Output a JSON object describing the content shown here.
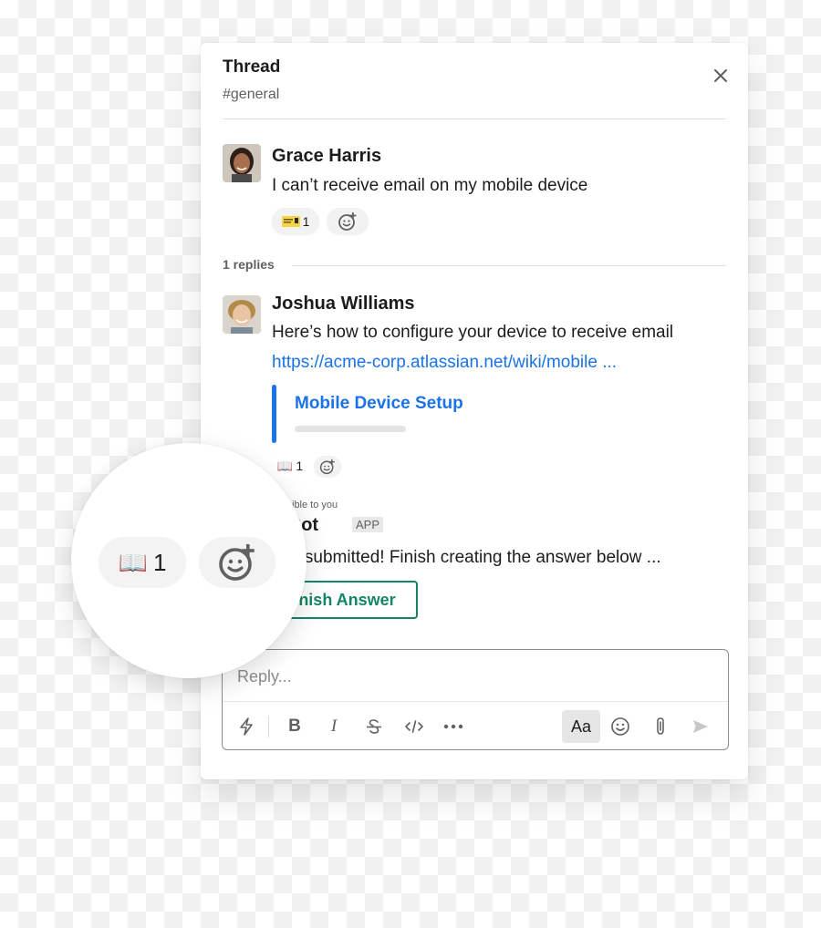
{
  "thread": {
    "title": "Thread",
    "channel": "#general"
  },
  "messages": [
    {
      "author": "Grace Harris",
      "text": "I can’t receive email on my mobile device",
      "reactions": [
        {
          "emoji": "ticket-emoji",
          "count": "1"
        }
      ]
    },
    {
      "author": "Joshua Williams",
      "text": "Here’s how to configure your device to receive email",
      "link": "https://acme-corp.atlassian.net/wiki/mobile ...",
      "attachment_title": "Mobile Device Setup",
      "reactions": [
        {
          "emoji": "📖",
          "count": "1"
        }
      ]
    }
  ],
  "replies_label": "1 replies",
  "bot": {
    "visibility_note": "y visible to you",
    "name": "p Bot",
    "badge": "APP",
    "text": "wer submitted! Finish creating the answer below ...",
    "button_label": "inish Answer"
  },
  "composer": {
    "placeholder": "Reply...",
    "format_label": "Aa"
  },
  "magnifier": {
    "emoji": "📖",
    "count": "1"
  },
  "colors": {
    "link": "#1a73e8",
    "accent_green": "#148567",
    "attachment_bar": "#1a73e8"
  }
}
